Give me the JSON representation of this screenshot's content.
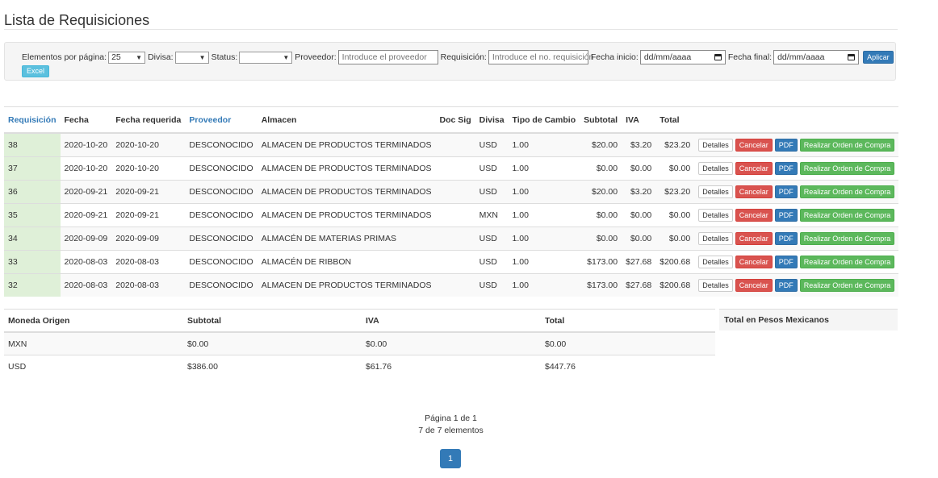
{
  "page": {
    "title": "Lista de Requisiciones"
  },
  "filters": {
    "per_page_label": "Elementos por página:",
    "per_page_value": "25",
    "currency_label": "Divisa:",
    "currency_value": "",
    "status_label": "Status:",
    "status_value": "",
    "supplier_label": "Proveedor:",
    "supplier_placeholder": "Introduce el proveedor",
    "requisition_label": "Requisición:",
    "requisition_placeholder": "Introduce el no. requisición",
    "start_label": "Fecha inicio:",
    "start_value": "dd/mm/aaaa",
    "end_label": "Fecha final:",
    "end_value": "dd/mm/aaaa",
    "apply_label": "Aplicar",
    "excel_label": "Excel"
  },
  "table": {
    "headers": {
      "id": "Requisición",
      "date": "Fecha",
      "required": "Fecha requerida",
      "supplier": "Proveedor",
      "warehouse": "Almacen",
      "docsig": "Doc Sig",
      "currency": "Divisa",
      "rate": "Tipo de Cambio",
      "subtotal": "Subtotal",
      "iva": "IVA",
      "total": "Total"
    },
    "actions": {
      "details": "Detalles",
      "cancel": "Cancelar",
      "pdf": "PDF",
      "order": "Realizar Orden de Compra"
    },
    "rows": [
      {
        "id": "38",
        "date": "2020-10-20",
        "required": "2020-10-20",
        "supplier": "DESCONOCIDO",
        "warehouse": "ALMACEN DE PRODUCTOS TERMINADOS",
        "docsig": "",
        "currency": "USD",
        "rate": "1.00",
        "subtotal": "$20.00",
        "iva": "$3.20",
        "total": "$23.20"
      },
      {
        "id": "37",
        "date": "2020-10-20",
        "required": "2020-10-20",
        "supplier": "DESCONOCIDO",
        "warehouse": "ALMACEN DE PRODUCTOS TERMINADOS",
        "docsig": "",
        "currency": "USD",
        "rate": "1.00",
        "subtotal": "$0.00",
        "iva": "$0.00",
        "total": "$0.00"
      },
      {
        "id": "36",
        "date": "2020-09-21",
        "required": "2020-09-21",
        "supplier": "DESCONOCIDO",
        "warehouse": "ALMACEN DE PRODUCTOS TERMINADOS",
        "docsig": "",
        "currency": "USD",
        "rate": "1.00",
        "subtotal": "$20.00",
        "iva": "$3.20",
        "total": "$23.20"
      },
      {
        "id": "35",
        "date": "2020-09-21",
        "required": "2020-09-21",
        "supplier": "DESCONOCIDO",
        "warehouse": "ALMACEN DE PRODUCTOS TERMINADOS",
        "docsig": "",
        "currency": "MXN",
        "rate": "1.00",
        "subtotal": "$0.00",
        "iva": "$0.00",
        "total": "$0.00"
      },
      {
        "id": "34",
        "date": "2020-09-09",
        "required": "2020-09-09",
        "supplier": "DESCONOCIDO",
        "warehouse": "ALMACÉN DE MATERIAS PRIMAS",
        "docsig": "",
        "currency": "USD",
        "rate": "1.00",
        "subtotal": "$0.00",
        "iva": "$0.00",
        "total": "$0.00"
      },
      {
        "id": "33",
        "date": "2020-08-03",
        "required": "2020-08-03",
        "supplier": "DESCONOCIDO",
        "warehouse": "ALMACÉN DE RIBBON",
        "docsig": "",
        "currency": "USD",
        "rate": "1.00",
        "subtotal": "$173.00",
        "iva": "$27.68",
        "total": "$200.68"
      },
      {
        "id": "32",
        "date": "2020-08-03",
        "required": "2020-08-03",
        "supplier": "DESCONOCIDO",
        "warehouse": "ALMACEN DE PRODUCTOS TERMINADOS",
        "docsig": "",
        "currency": "USD",
        "rate": "1.00",
        "subtotal": "$173.00",
        "iva": "$27.68",
        "total": "$200.68"
      }
    ]
  },
  "totals": {
    "headers": {
      "currency": "Moneda Origen",
      "subtotal": "Subtotal",
      "iva": "IVA",
      "total": "Total"
    },
    "mxn_header": "Total en Pesos Mexicanos",
    "rows": [
      {
        "currency": "MXN",
        "subtotal": "$0.00",
        "iva": "$0.00",
        "total": "$0.00"
      },
      {
        "currency": "USD",
        "subtotal": "$386.00",
        "iva": "$61.76",
        "total": "$447.76"
      }
    ]
  },
  "pagination": {
    "page_text": "Página 1 de 1",
    "count_text": "7 de 7 elementos",
    "current": "1"
  },
  "colors": {
    "primary": "#337ab7",
    "danger": "#d9534f",
    "success": "#5cb85c",
    "info": "#5bc0de",
    "id_bg": "#dff0d8"
  }
}
